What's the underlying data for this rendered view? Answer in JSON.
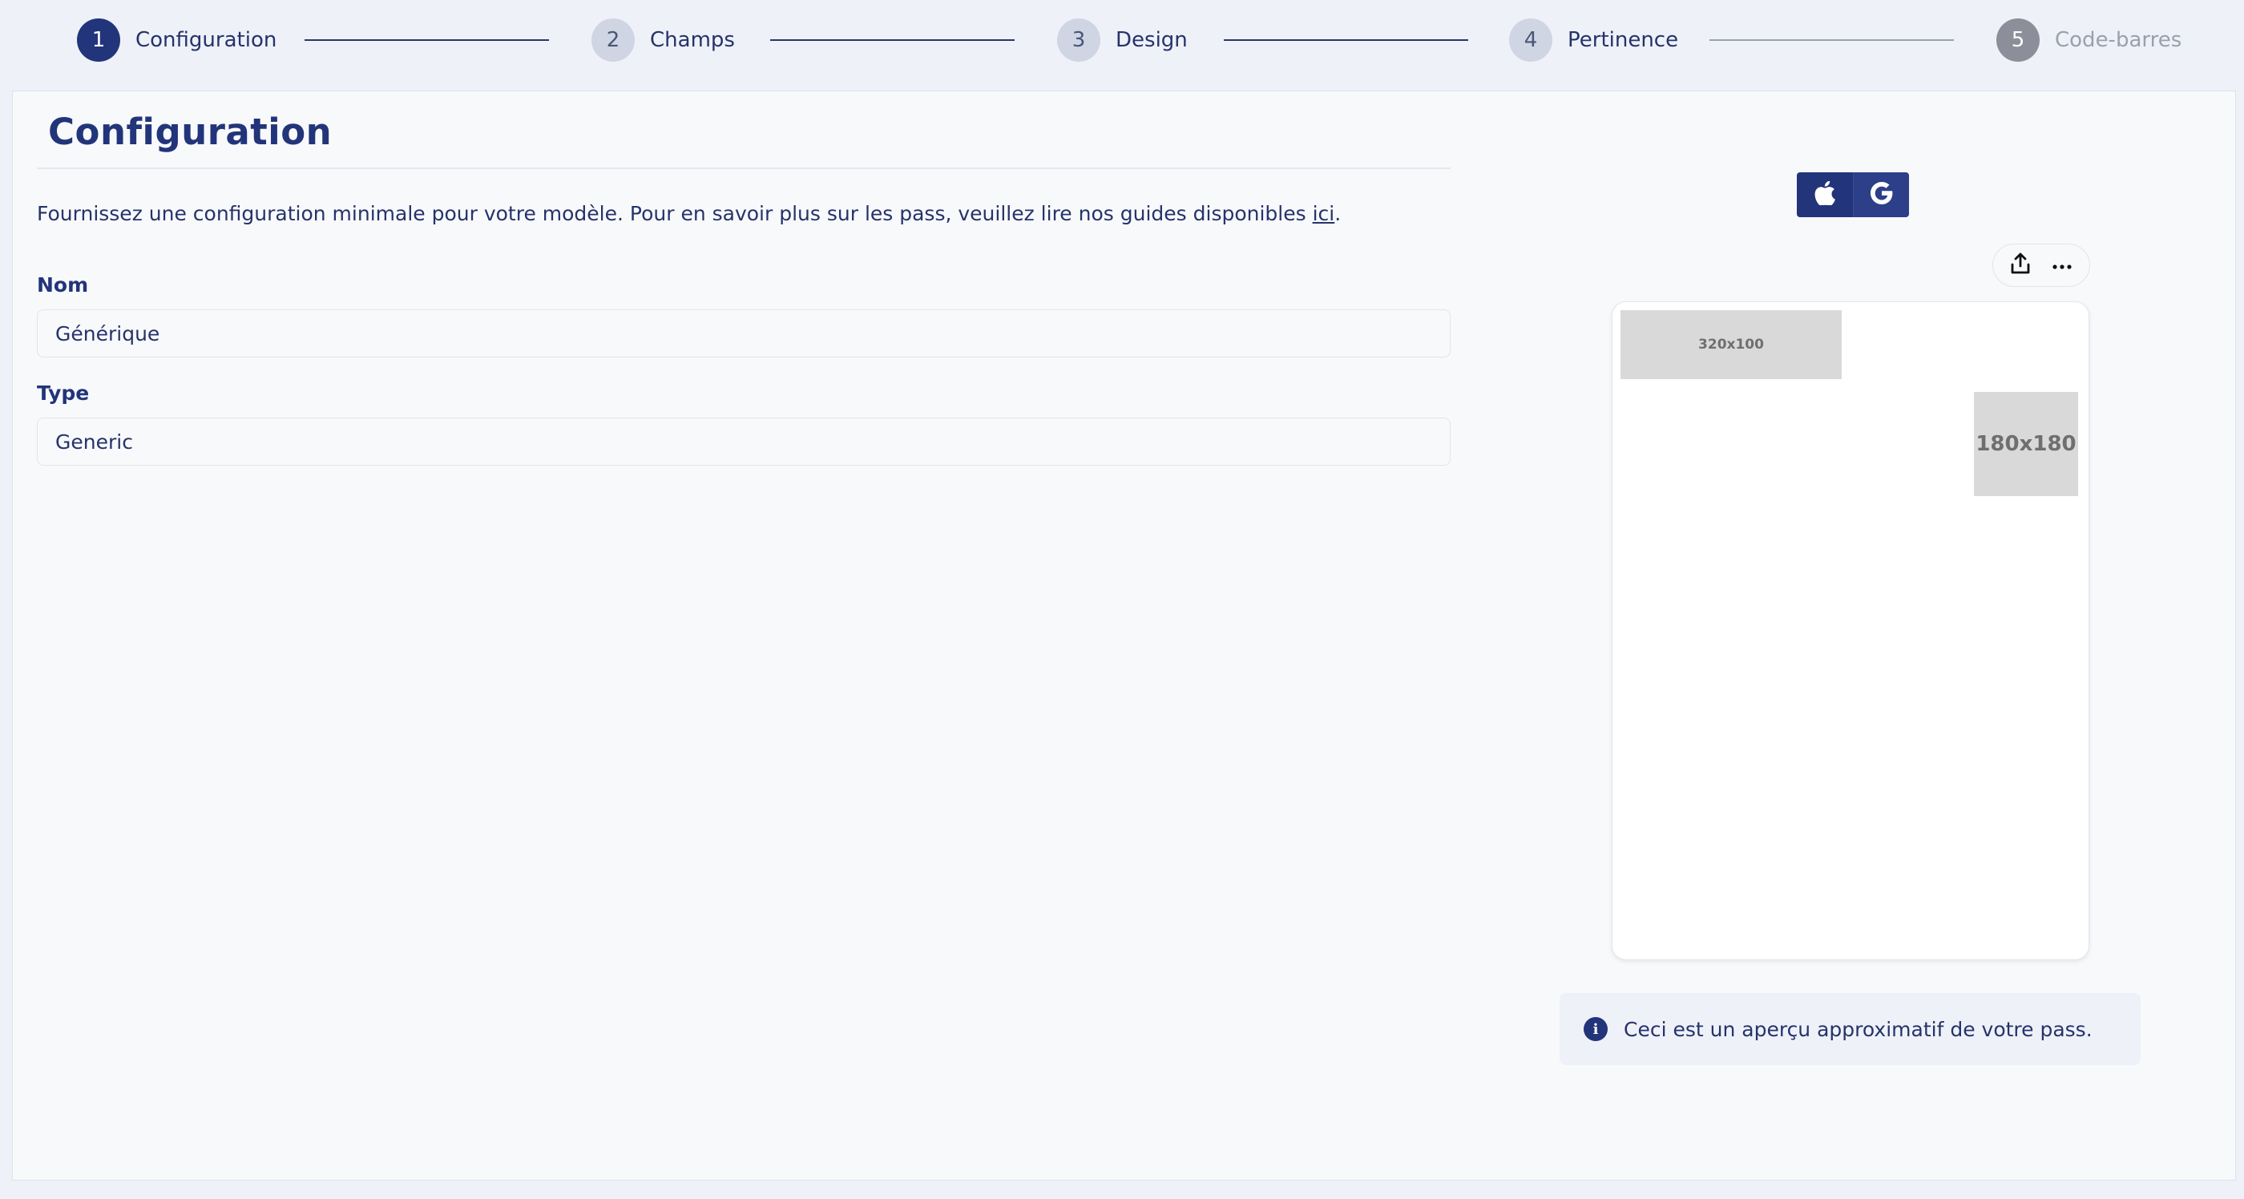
{
  "stepper": {
    "steps": [
      {
        "number": "1",
        "label": "Configuration",
        "state": "active"
      },
      {
        "number": "2",
        "label": "Champs",
        "state": "pending"
      },
      {
        "number": "3",
        "label": "Design",
        "state": "pending"
      },
      {
        "number": "4",
        "label": "Pertinence",
        "state": "pending"
      },
      {
        "number": "5",
        "label": "Code-barres",
        "state": "disabled"
      }
    ]
  },
  "page": {
    "title": "Configuration",
    "intro_text": "Fournissez une configuration minimale pour votre modèle. Pour en savoir plus sur les pass, veuillez lire nos guides disponibles ",
    "intro_link": "ici",
    "intro_end": "."
  },
  "form": {
    "name_label": "Nom",
    "name_value": "Générique",
    "type_label": "Type",
    "type_value": "Generic"
  },
  "preview": {
    "platforms": [
      "apple-icon",
      "google-icon"
    ],
    "selected_platform": "apple",
    "actions": [
      "share-icon",
      "more-icon"
    ],
    "logo_placeholder": "320x100",
    "thumbnail_placeholder": "180x180",
    "info_text": "Ceci est un aperçu approximatif de votre pass."
  },
  "colors": {
    "primary": "#22347a",
    "background": "#eef1f8",
    "panel": "#f8f9fb",
    "placeholder": "#d9d9d9"
  }
}
